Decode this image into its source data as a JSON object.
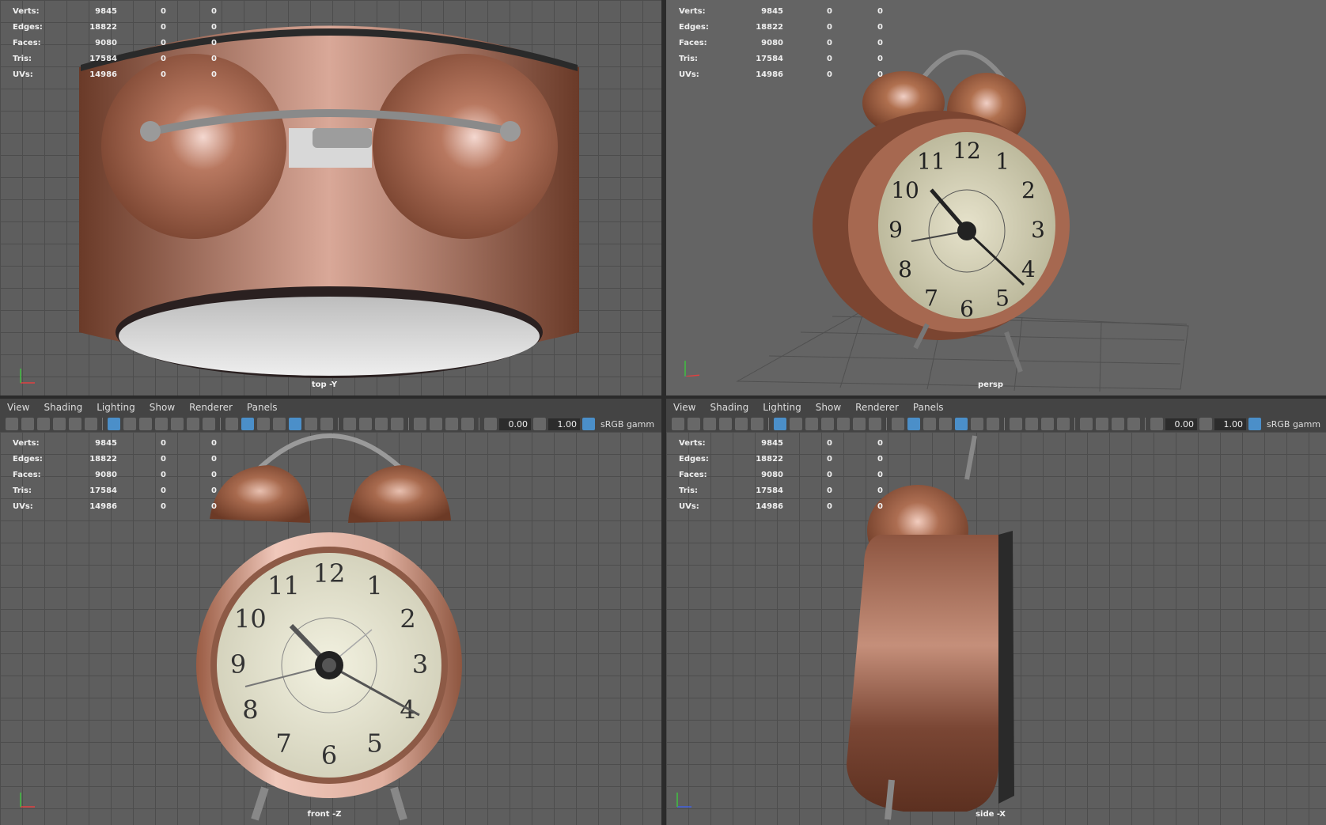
{
  "hud": {
    "rows": [
      {
        "label": "Verts:",
        "v1": "9845",
        "v2": "0",
        "v3": "0"
      },
      {
        "label": "Edges:",
        "v1": "18822",
        "v2": "0",
        "v3": "0"
      },
      {
        "label": "Faces:",
        "v1": "9080",
        "v2": "0",
        "v3": "0"
      },
      {
        "label": "Tris:",
        "v1": "17584",
        "v2": "0",
        "v3": "0"
      },
      {
        "label": "UVs:",
        "v1": "14986",
        "v2": "0",
        "v3": "0"
      }
    ]
  },
  "panels": {
    "top": {
      "camera": "top -Y"
    },
    "persp": {
      "camera": "persp"
    },
    "front": {
      "camera": "front -Z"
    },
    "side": {
      "camera": "side -X"
    }
  },
  "menu": {
    "view": "View",
    "shading": "Shading",
    "lighting": "Lighting",
    "show": "Show",
    "renderer": "Renderer",
    "panels": "Panels"
  },
  "toolbar": {
    "exposure": "0.00",
    "gamma": "1.00",
    "colorspace": "sRGB gamm"
  },
  "clock": {
    "numerals": [
      "12",
      "1",
      "2",
      "3",
      "4",
      "5",
      "6",
      "7",
      "8",
      "9",
      "10",
      "11"
    ]
  },
  "colors": {
    "copper": "#a5694f",
    "face": "#d8d6bf",
    "grid": "#4d4d4d",
    "background": "#5e5e5e"
  }
}
